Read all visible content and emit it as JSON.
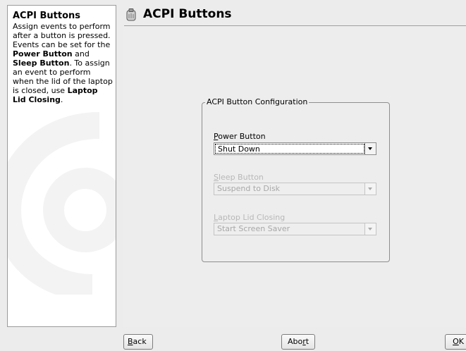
{
  "help": {
    "title": "ACPI Buttons",
    "text_parts": [
      "Assign events to perform after a button is pressed. Events can be set for the ",
      "Power Button",
      " and ",
      "Sleep Button",
      ". To assign an event to perform when the lid of the laptop is closed, use ",
      "Laptop Lid Closing",
      "."
    ]
  },
  "header": {
    "title": "ACPI Buttons",
    "icon": "acpi-module-icon"
  },
  "group": {
    "title": "ACPI Button Configuration",
    "power": {
      "label_first": "P",
      "label_rest": "ower Button",
      "value": "Shut Down",
      "enabled": true
    },
    "sleep": {
      "label_first": "S",
      "label_rest": "leep Button",
      "value": "Suspend to Disk",
      "enabled": false
    },
    "lid": {
      "label_first": "L",
      "label_rest": "aptop Lid Closing",
      "value": "Start Screen Saver",
      "enabled": false
    }
  },
  "buttons": {
    "back": {
      "first": "B",
      "rest": "ack"
    },
    "abort": {
      "before": "Abo",
      "ul": "r",
      "after": "t"
    },
    "ok": {
      "first": "O",
      "rest": "K"
    }
  }
}
